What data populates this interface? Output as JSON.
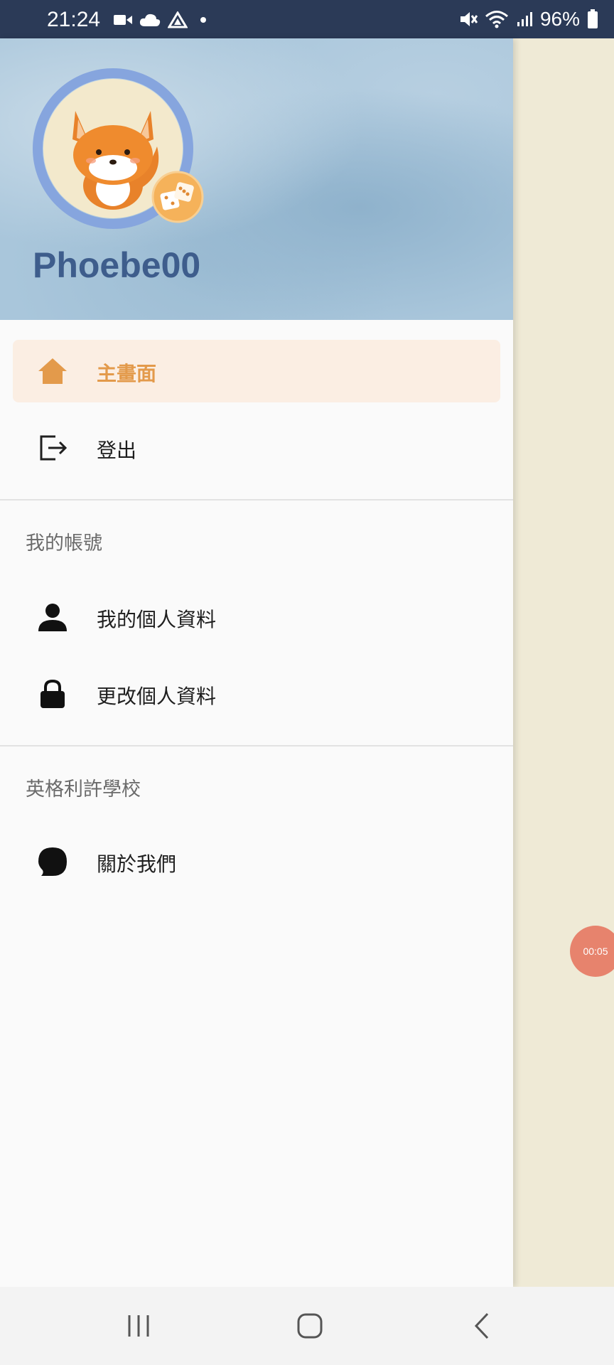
{
  "status_bar": {
    "time": "21:24",
    "battery": "96%",
    "icons": [
      "video-icon",
      "cloud-icon",
      "drive-icon",
      "dot-icon",
      "mute-icon",
      "wifi-icon",
      "signal-icon",
      "battery-icon"
    ]
  },
  "drawer": {
    "username": "Phoebe00",
    "items_top": [
      {
        "label": "主畫面",
        "icon": "home-icon",
        "active": true
      },
      {
        "label": "登出",
        "icon": "logout-icon",
        "active": false
      }
    ],
    "sections": [
      {
        "title": "我的帳號",
        "items": [
          {
            "label": "我的個人資料",
            "icon": "person-icon"
          },
          {
            "label": "更改個人資料",
            "icon": "lock-icon"
          }
        ]
      },
      {
        "title": "英格利許學校",
        "items": [
          {
            "label": "關於我們",
            "icon": "chat-bubble-icon"
          }
        ]
      }
    ]
  },
  "overlay": {
    "timer": "00:05"
  },
  "colors": {
    "accent": "#E39A4B",
    "active_bg": "#FBEEE3",
    "username": "#3E5D8C",
    "status_bar": "#2B3A57",
    "timer_bubble": "#E7836D"
  }
}
